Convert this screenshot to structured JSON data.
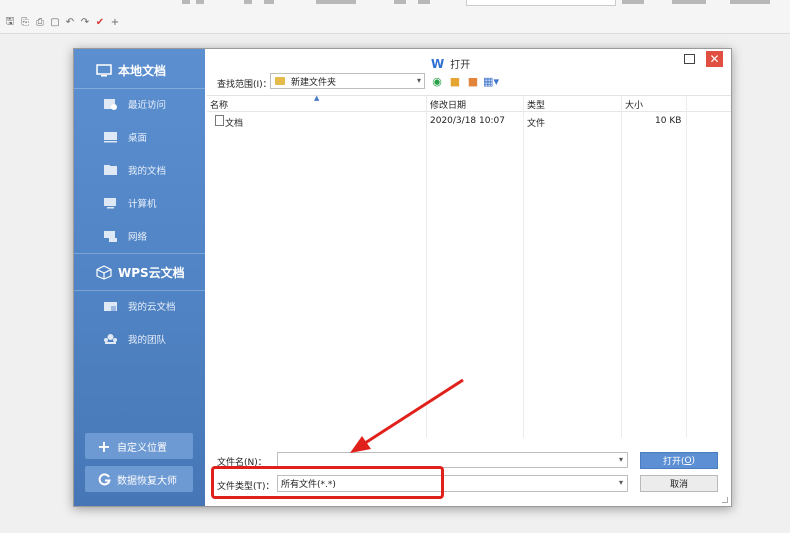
{
  "dialog": {
    "title": "打开",
    "close_glyph": "✕"
  },
  "sidebar": {
    "local_header": "本地文档",
    "local_items": [
      {
        "label": "最近访问",
        "icon": "recent-icon"
      },
      {
        "label": "桌面",
        "icon": "desktop-icon"
      },
      {
        "label": "我的文档",
        "icon": "documents-icon"
      },
      {
        "label": "计算机",
        "icon": "computer-icon"
      },
      {
        "label": "网络",
        "icon": "network-icon"
      }
    ],
    "cloud_header": "WPS云文档",
    "cloud_items": [
      {
        "label": "我的云文档",
        "icon": "cloud-docs-icon"
      },
      {
        "label": "我的团队",
        "icon": "team-icon"
      }
    ],
    "custom_location_button": "自定义位置",
    "data_recovery_button": "数据恢复大师"
  },
  "location": {
    "label": "查找范围(I)：",
    "value": "新建文件夹"
  },
  "file_list": {
    "columns": [
      "名称",
      "修改日期",
      "类型",
      "大小"
    ],
    "rows": [
      {
        "name": "文档",
        "modified": "2020/3/18 10:07",
        "type": "文件",
        "size": "10 KB"
      }
    ]
  },
  "filename": {
    "label": "文件名(N)：",
    "value": ""
  },
  "filetype": {
    "label": "文件类型(T)：",
    "value": "所有文件(*.*)"
  },
  "buttons": {
    "open_label": "打开(",
    "open_key": "O",
    "open_suffix": ")",
    "cancel": "取消"
  },
  "colors": {
    "sidebar": "#4f82c2",
    "close_button": "#e04f3f",
    "annotation": "#e0201b"
  }
}
